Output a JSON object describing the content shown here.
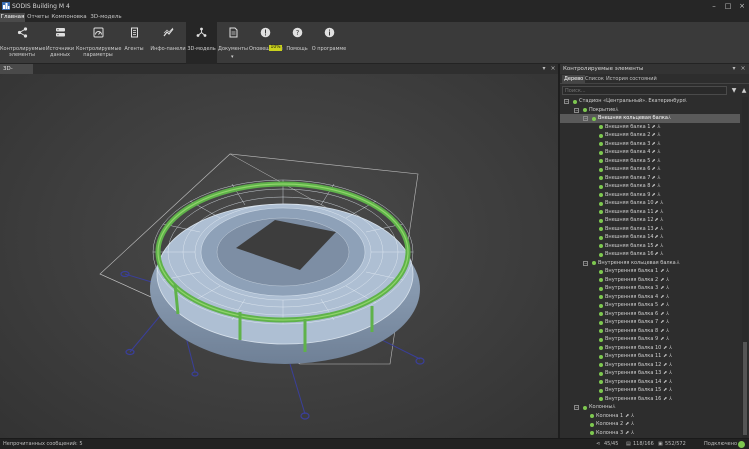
{
  "app": {
    "title": "SODIS Building M 4"
  },
  "menu": [
    {
      "label": "Главная",
      "active": true
    },
    {
      "label": "Отчеты",
      "active": false
    },
    {
      "label": "Компоновка",
      "active": false
    },
    {
      "label": "3D-модель",
      "active": false
    }
  ],
  "ribbon": [
    {
      "label": "Контролируемые\nэлементы",
      "icon": "share-icon",
      "active": false
    },
    {
      "label": "Источники\nданных",
      "icon": "database-icon",
      "active": false
    },
    {
      "label": "Контролируемые\nпараметры",
      "icon": "dashboard-icon",
      "active": false
    },
    {
      "label": "Агенты",
      "icon": "agent-icon",
      "active": false
    },
    {
      "label": "Инфо-панели",
      "icon": "trend-icon",
      "active": false
    },
    {
      "label": "3D-модель",
      "icon": "model-icon",
      "active": true
    },
    {
      "label": "Документы",
      "icon": "document-icon",
      "active": false
    },
    {
      "label": "Оповещения",
      "icon": "alert-icon",
      "active": false
    },
    {
      "label": "Помощь",
      "icon": "help-icon",
      "active": false
    },
    {
      "label": "О программе",
      "icon": "info-icon",
      "active": false
    }
  ],
  "ribbon_badge": "10%",
  "viewport": {
    "tab_label": "3D-модель"
  },
  "right_panel": {
    "title": "Контролируемые элементы",
    "tabs": [
      "Дерево",
      "Список",
      "История состояний"
    ],
    "active_tab": "Дерево",
    "search_placeholder": "Поиск..."
  },
  "tree": {
    "root": "Стадион «Центральный». Екатеринбург",
    "coating": "Покрытие",
    "outer_ring": "Внешняя кольцевая балка",
    "outer_beams": [
      "Внешняя балка 1",
      "Внешняя балка 2",
      "Внешняя балка 3",
      "Внешняя балка 4",
      "Внешняя балка 5",
      "Внешняя балка 6",
      "Внешняя балка 7",
      "Внешняя балка 8",
      "Внешняя балка 9",
      "Внешняя балка 10",
      "Внешняя балка 11",
      "Внешняя балка 12",
      "Внешняя балка 13",
      "Внешняя балка 14",
      "Внешняя балка 15",
      "Внешняя балка 16"
    ],
    "inner_ring": "Внутренняя кольцевая балка",
    "inner_beams": [
      "Внутренняя балка 1",
      "Внутренняя балка 2",
      "Внутренняя балка 3",
      "Внутренняя балка 4",
      "Внутренняя балка 5",
      "Внутренняя балка 6",
      "Внутренняя балка 7",
      "Внутренняя балка 8",
      "Внутренняя балка 9",
      "Внутренняя балка 10",
      "Внутренняя балка 11",
      "Внутренняя балка 12",
      "Внутренняя балка 13",
      "Внутренняя балка 14",
      "Внутренняя балка 15",
      "Внутренняя балка 16"
    ],
    "columns": "Колонны",
    "column_items": [
      "Колонна 1",
      "Колонна 2",
      "Колонна 3"
    ]
  },
  "status": {
    "unread": "Непрочитанных сообщений: 5",
    "share_count": "45/45",
    "db_count": "118/166",
    "param_count": "552/572",
    "connected": "Подключено"
  },
  "colors": {
    "status_ok": "#7ec850",
    "accent_green": "#3fa34d",
    "badge": "#c9d11d"
  }
}
